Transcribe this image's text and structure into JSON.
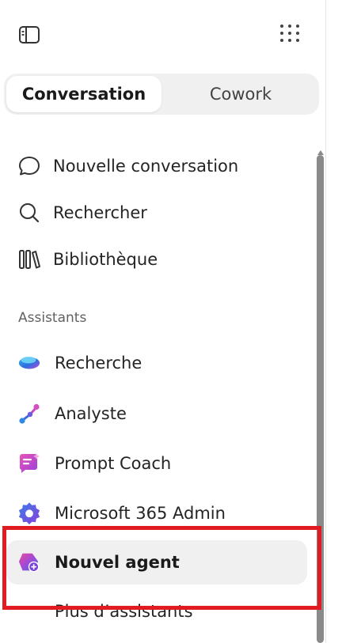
{
  "tabs": [
    {
      "label": "Conversation",
      "active": true
    },
    {
      "label": "Cowork",
      "active": false
    }
  ],
  "nav": {
    "new_conversation": "Nouvelle conversation",
    "search": "Rechercher",
    "library": "Bibliothèque"
  },
  "assistants": {
    "section_label": "Assistants",
    "items": [
      {
        "label": "Recherche",
        "icon": "researcher-icon"
      },
      {
        "label": "Analyste",
        "icon": "analyst-icon"
      },
      {
        "label": "Prompt Coach",
        "icon": "prompt-coach-icon"
      },
      {
        "label": "Microsoft 365 Admin",
        "icon": "admin-gear-icon"
      },
      {
        "label": "Nouvel agent",
        "icon": "new-agent-icon",
        "selected": true
      },
      {
        "label": "Plus d’assistants"
      }
    ]
  },
  "colors": {
    "highlight": "#e01b22",
    "selected_bg": "#f0f0f0"
  }
}
